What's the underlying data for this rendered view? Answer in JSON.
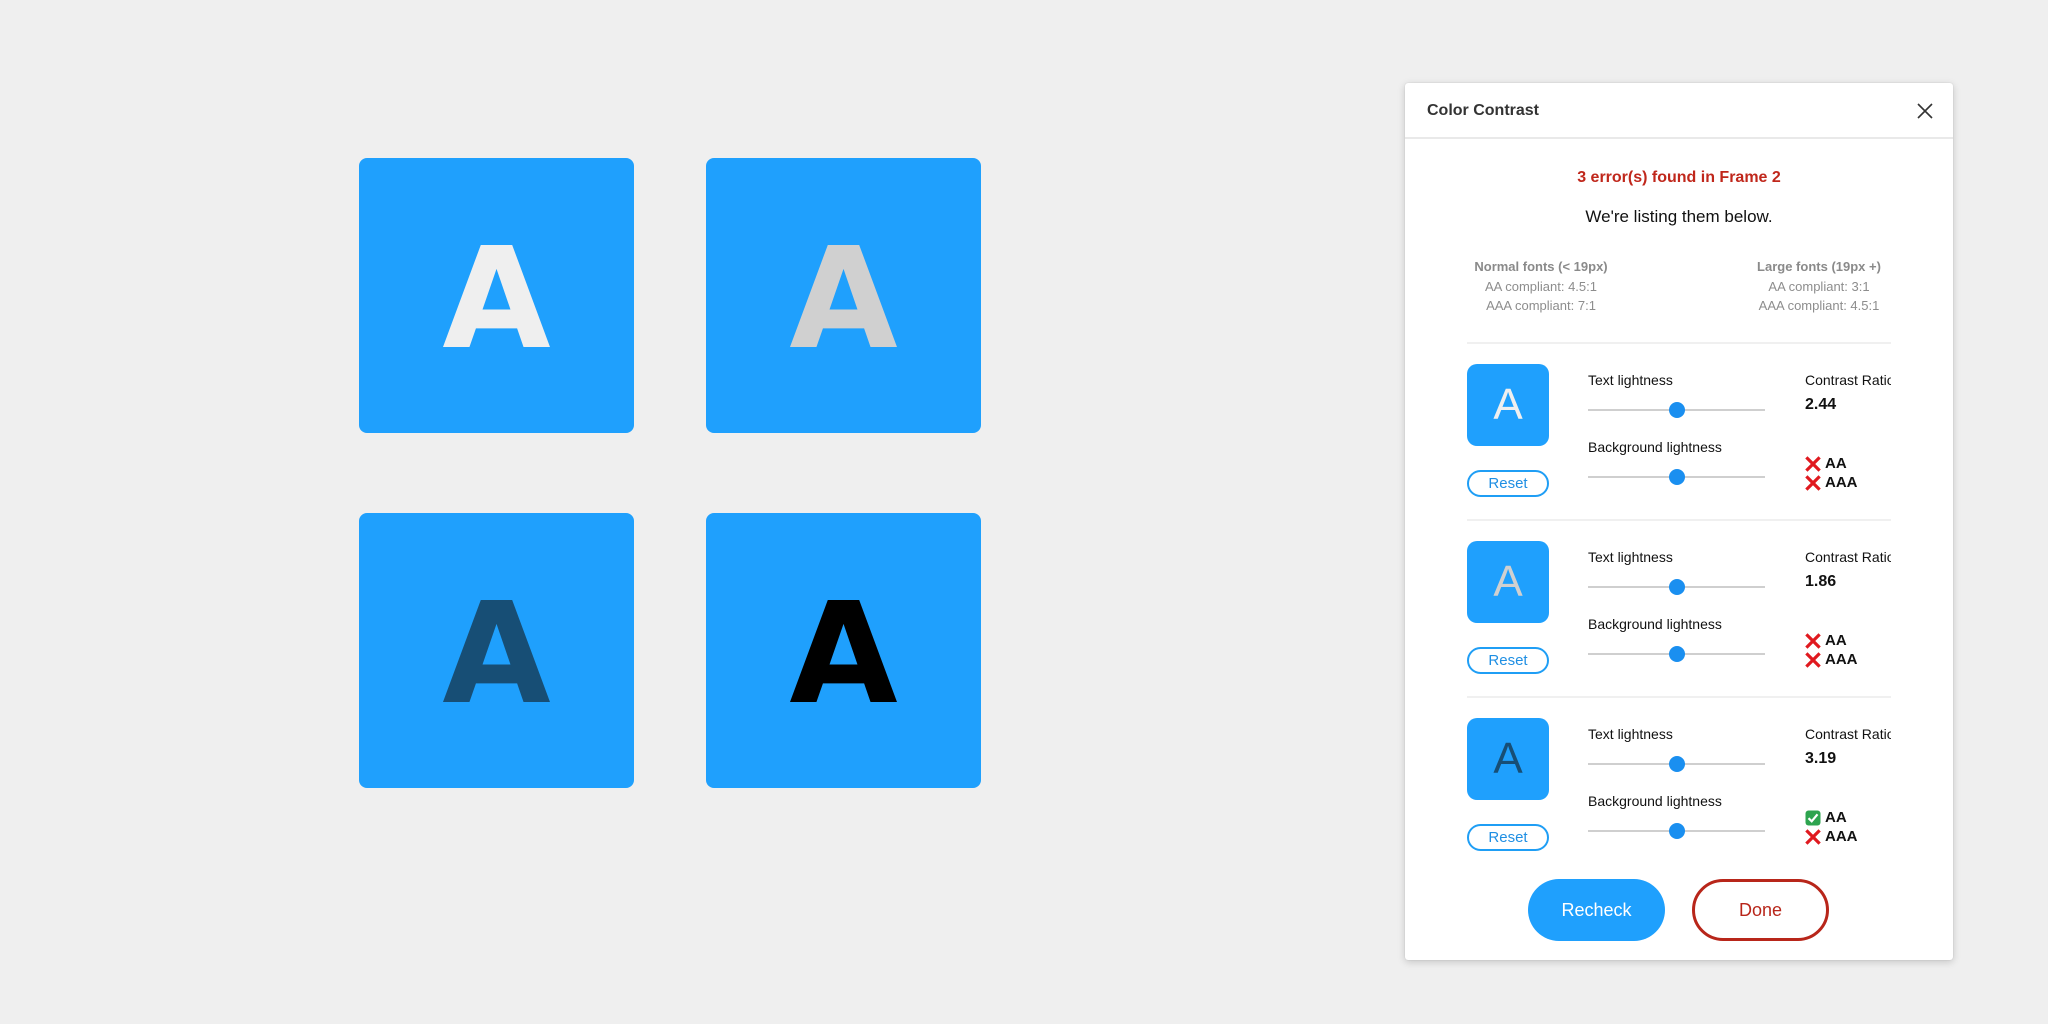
{
  "canvas": {
    "background": "#efefef",
    "tiles": [
      {
        "letter": "A",
        "background": "#1fa0fd",
        "text_color": "#efefef"
      },
      {
        "letter": "A",
        "background": "#1fa0fd",
        "text_color": "#d0d0d0"
      },
      {
        "letter": "A",
        "background": "#1fa0fd",
        "text_color": "#174e75"
      },
      {
        "letter": "A",
        "background": "#1fa0fd",
        "text_color": "#000000"
      }
    ]
  },
  "dialog": {
    "title": "Color Contrast",
    "close_icon": "close-icon",
    "error_summary": "3 error(s) found in Frame 2",
    "subtitle": "We're listing them below.",
    "requirements": {
      "normal": {
        "heading": "Normal fonts (< 19px)",
        "aa": "AA compliant: 4.5:1",
        "aaa": "AAA compliant: 7:1"
      },
      "large": {
        "heading": "Large fonts (19px +)",
        "aa": "AA compliant: 3:1",
        "aaa": "AAA compliant: 4.5:1"
      }
    },
    "labels": {
      "text_lightness": "Text lightness",
      "background_lightness": "Background lightness",
      "contrast_ratio": "Contrast Ratio",
      "reset": "Reset",
      "aa": "AA",
      "aaa": "AAA"
    },
    "errors": [
      {
        "preview_letter": "A",
        "preview_background": "#1fa0fd",
        "preview_text_color": "#efefef",
        "text_lightness": 0.5,
        "background_lightness": 0.5,
        "contrast_ratio": "2.44",
        "aa_pass": false,
        "aaa_pass": false
      },
      {
        "preview_letter": "A",
        "preview_background": "#1fa0fd",
        "preview_text_color": "#d0d0d0",
        "text_lightness": 0.5,
        "background_lightness": 0.5,
        "contrast_ratio": "1.86",
        "aa_pass": false,
        "aaa_pass": false
      },
      {
        "preview_letter": "A",
        "preview_background": "#1fa0fd",
        "preview_text_color": "#174e75",
        "text_lightness": 0.5,
        "background_lightness": 0.5,
        "contrast_ratio": "3.19",
        "aa_pass": true,
        "aaa_pass": false
      }
    ],
    "buttons": {
      "recheck": "Recheck",
      "done": "Done"
    },
    "colors": {
      "accent": "#1fa0fd",
      "error": "#c0271b",
      "done_border": "#b8261a",
      "fail_icon": "#e0191f",
      "pass_icon": "#2ea44f"
    }
  }
}
